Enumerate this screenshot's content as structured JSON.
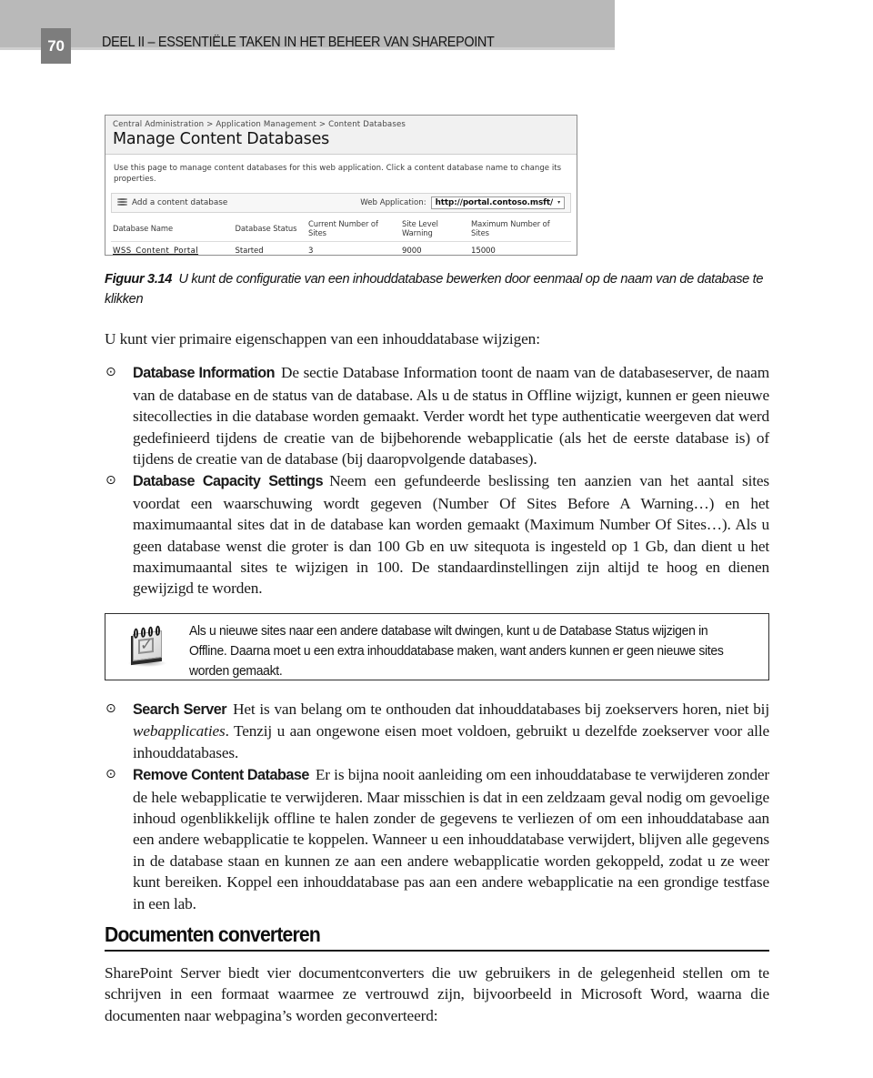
{
  "page": {
    "folio": "70",
    "running_head": "DEEL II – ESSENTIËLE TAKEN IN HET BEHEER VAN SHAREPOINT"
  },
  "figure": {
    "caption_label": "Figuur 3.14",
    "caption_text": "U kunt de configuratie van een inhouddatabase bewerken door eenmaal op de naam van de database te klikken",
    "screenshot": {
      "breadcrumb": "Central Administration > Application Management > Content Databases",
      "title": "Manage Content Databases",
      "description": "Use this page to manage content databases for this web application. Click a content database name to change its properties.",
      "toolbar": {
        "add_label": "Add a content database",
        "webapp_label": "Web Application:",
        "webapp_value": "http://portal.contoso.msft/",
        "caret": "▾"
      },
      "table": {
        "headers": [
          "Database Name",
          "Database Status",
          "Current Number of Sites",
          "Site Level Warning",
          "Maximum Number of Sites"
        ],
        "rows": [
          [
            "WSS_Content_Portal",
            "Started",
            "3",
            "9000",
            "15000"
          ]
        ]
      }
    }
  },
  "body": {
    "lead_paragraph": "U kunt vier primaire eigenschappen van een inhouddatabase wijzigen:",
    "bullet_marker": "⊙",
    "bullets": [
      {
        "term": "Database Information",
        "text": "De sectie Database Information toont de naam van de databaseserver, de naam van de database en de status van de database. Als u de status in Offline wijzigt, kunnen er geen nieuwe sitecollecties in die database worden gemaakt. Verder wordt het type authenticatie weergeven dat werd gedefinieerd tijdens de creatie van de bijbehorende webapplicatie (als het de eerste database is) of tijdens de creatie van de database (bij daaropvolgende databases)."
      },
      {
        "term": "Database Capacity Settings",
        "text": "Neem een gefundeerde beslissing ten aanzien van het aantal sites voordat een waarschuwing wordt gegeven (Number Of Sites Before A Warning…) en het maximumaantal sites dat in de database kan worden gemaakt (Maximum Number Of Sites…). Als u geen database wenst die groter is dan 100 Gb en uw sitequota is ingesteld op 1 Gb, dan dient u het maximumaantal sites te wijzigen in 100. De standaardinstellingen zijn altijd te hoog en dienen gewijzigd te worden."
      }
    ],
    "bullets_lower": [
      {
        "term": "Search Server",
        "text_pre": "Het is van belang om te onthouden dat inhouddatabases bij zoekservers horen, niet bij ",
        "emphasis": "webapplicaties",
        "text_post": ". Tenzij u aan ongewone eisen moet voldoen, gebruikt u dezelfde zoekserver voor alle inhouddatabases."
      },
      {
        "term": "Remove Content Database",
        "text": "Er is bijna nooit aanleiding om een inhouddatabase te verwijderen zonder de hele webapplicatie te verwijderen. Maar misschien is dat in een zeldzaam geval nodig om gevoelige inhoud ogenblikkelijk offline te halen zonder de gegevens te verliezen of om een inhouddatabase aan een andere webapplicatie te koppelen. Wanneer u een inhouddatabase verwijdert, blijven alle gegevens in de database staan en kunnen ze aan een andere webapplicatie worden gekoppeld, zodat u ze weer kunt bereiken. Koppel een inhouddatabase pas aan een andere webapplicatie na een grondige testfase in een lab."
      }
    ]
  },
  "note": {
    "icon": "notepad-check-icon",
    "text": "Als u nieuwe sites naar een andere database wilt dwingen, kunt u de Database Status wijzigen in Offline. Daarna moet u een extra inhouddatabase maken, want anders kunnen er geen nieuwe sites worden gemaakt."
  },
  "section": {
    "heading": "Documenten converteren",
    "paragraph": "SharePoint Server biedt vier documentconverters die uw gebruikers in de gelegenheid stellen om te schrijven in een formaat waarmee ze vertrouwd zijn, bijvoorbeeld in Microsoft Word, waarna die documenten naar webpagina’s worden geconverteerd:"
  },
  "colors": {
    "scan_band": "#b9b9b9",
    "folio_box": "#7d7d7d",
    "ink": "#1a1a1a"
  }
}
